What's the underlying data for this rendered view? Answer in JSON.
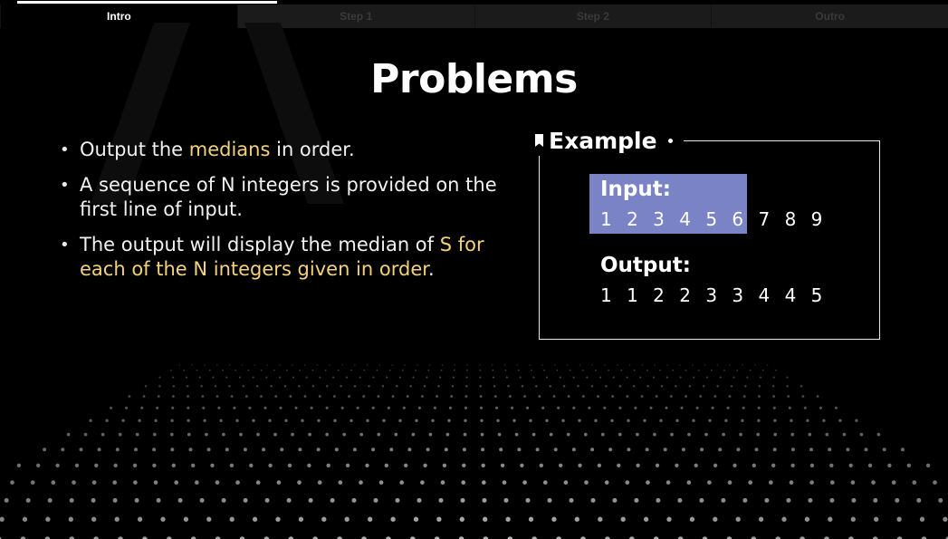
{
  "tabs": [
    {
      "label": "Intro",
      "active": true
    },
    {
      "label": "Step 1",
      "active": false
    },
    {
      "label": "Step 2",
      "active": false
    },
    {
      "label": "Outro",
      "active": false
    }
  ],
  "title": "Problems",
  "bullets": [
    {
      "parts": [
        {
          "text": "Output the ",
          "hl": false
        },
        {
          "text": "medians",
          "hl": true
        },
        {
          "text": " in order.",
          "hl": false
        }
      ]
    },
    {
      "parts": [
        {
          "text": "A sequence of N integers is provided on the first line of input.",
          "hl": false
        }
      ]
    },
    {
      "parts": [
        {
          "text": "The output will display the median of ",
          "hl": false
        },
        {
          "text": "S for each of the N integers given in order",
          "hl": true
        },
        {
          "text": ".",
          "hl": false
        }
      ]
    }
  ],
  "example": {
    "heading": "Example",
    "input_label": "Input:",
    "input_value": "1 2 3 4 5 6 7 8 9",
    "output_label": "Output:",
    "output_value": "1 1 2 2 3 3 4 4 5"
  },
  "colors": {
    "highlight": "#f4d27a",
    "input_bg": "#7b83c7",
    "background": "#000000"
  },
  "icons": [
    "bookmark-icon",
    "dot-icon"
  ]
}
